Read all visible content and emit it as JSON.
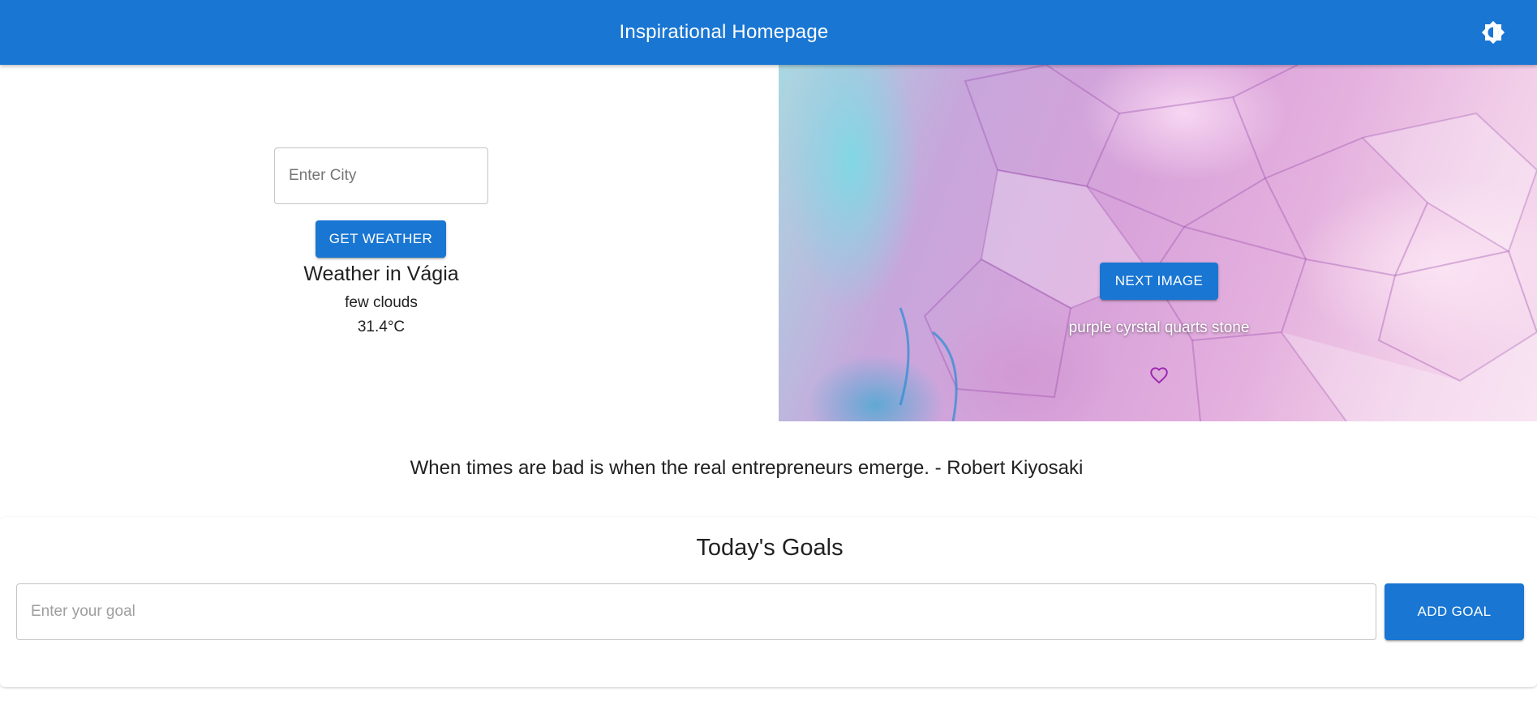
{
  "appbar": {
    "title": "Inspirational Homepage",
    "theme_icon": "brightness-icon",
    "color": "#1976d2"
  },
  "weather": {
    "city_placeholder": "Enter City",
    "city_value": "",
    "button_label": "GET WEATHER",
    "title": "Weather in Vágia",
    "description": "few clouds",
    "temperature": "31.4°C"
  },
  "image": {
    "next_label": "NEXT IMAGE",
    "caption": "purple cyrstal quarts stone",
    "favorite_icon": "heart-outline-icon",
    "favorite_color": "#9c27b0"
  },
  "quote": {
    "text": "When times are bad is when the real entrepreneurs emerge. - Robert Kiyosaki"
  },
  "goals": {
    "title": "Today's Goals",
    "input_placeholder": "Enter your goal",
    "input_value": "",
    "add_label": "ADD GOAL"
  }
}
